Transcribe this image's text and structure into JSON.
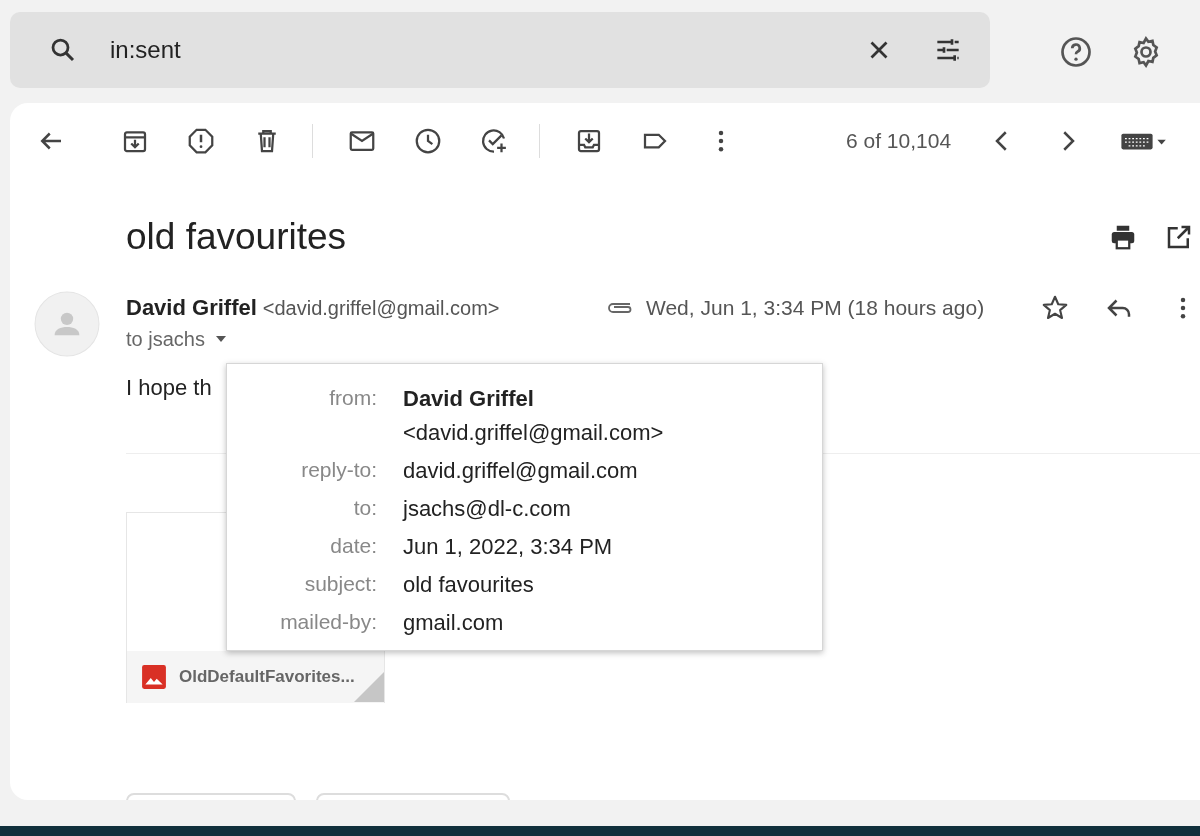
{
  "search": {
    "value": "in:sent"
  },
  "toolbar": {
    "counter": "6 of 10,104"
  },
  "message": {
    "subject": "old favourites",
    "sender_name": "David Griffel",
    "sender_email": "<david.griffel@gmail.com>",
    "recipients": "to jsachs",
    "date": "Wed, Jun 1, 3:34 PM (18 hours ago)",
    "body": "I hope th",
    "attachment": {
      "name": "OldDefaultFavorites..."
    }
  },
  "details_popup": {
    "from": {
      "label": "from:",
      "name": "David Griffel",
      "email": "<david.griffel@gmail.com>"
    },
    "rows": [
      {
        "label": "reply-to:",
        "value": "david.griffel@gmail.com"
      },
      {
        "label": "to:",
        "value": "jsachs@dl-c.com"
      },
      {
        "label": "date:",
        "value": "Jun 1, 2022, 3:34 PM"
      },
      {
        "label": "subject:",
        "value": "old favourites"
      },
      {
        "label": "mailed-by:",
        "value": "gmail.com"
      }
    ]
  }
}
